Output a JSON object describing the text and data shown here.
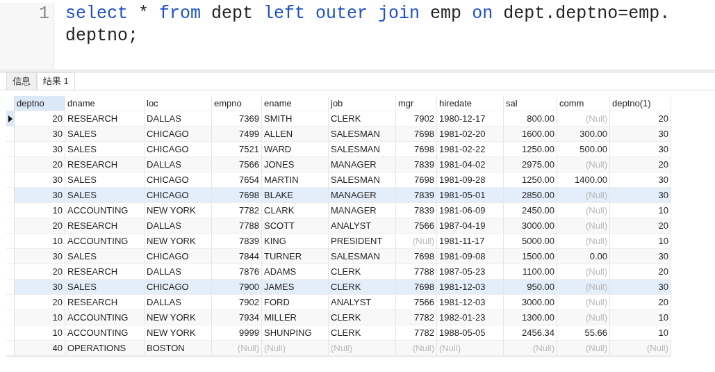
{
  "editor": {
    "line_number": "1",
    "tokens": [
      {
        "text": "select",
        "kind": "keyword"
      },
      {
        "text": " * ",
        "kind": "plain"
      },
      {
        "text": "from",
        "kind": "keyword"
      },
      {
        "text": " dept ",
        "kind": "plain"
      },
      {
        "text": "left outer join",
        "kind": "keyword"
      },
      {
        "text": " emp ",
        "kind": "plain"
      },
      {
        "text": "on",
        "kind": "keyword"
      },
      {
        "text": " dept.deptno=emp.deptno;",
        "kind": "plain"
      }
    ]
  },
  "tabs": [
    {
      "label": "信息",
      "selected": false
    },
    {
      "label": "结果 1",
      "selected": true
    }
  ],
  "table": {
    "columns": [
      {
        "label": "deptno",
        "kind": "number",
        "selected": true
      },
      {
        "label": "dname",
        "kind": "text",
        "selected": false
      },
      {
        "label": "loc",
        "kind": "text",
        "selected": false
      },
      {
        "label": "empno",
        "kind": "number",
        "selected": false
      },
      {
        "label": "ename",
        "kind": "text",
        "selected": false
      },
      {
        "label": "job",
        "kind": "text",
        "selected": false
      },
      {
        "label": "mgr",
        "kind": "number",
        "selected": false
      },
      {
        "label": "hiredate",
        "kind": "text",
        "selected": false
      },
      {
        "label": "sal",
        "kind": "number",
        "selected": false
      },
      {
        "label": "comm",
        "kind": "number",
        "selected": false
      },
      {
        "label": "deptno(1)",
        "kind": "number",
        "selected": false
      }
    ],
    "rows": [
      {
        "current": true,
        "highlighted": false,
        "cells": [
          "20",
          "RESEARCH",
          "DALLAS",
          "7369",
          "SMITH",
          "CLERK",
          "7902",
          "1980-12-17",
          "800.00",
          {
            "text": "(Null)",
            "kind": "null"
          },
          "20"
        ]
      },
      {
        "current": false,
        "highlighted": false,
        "cells": [
          "30",
          "SALES",
          "CHICAGO",
          "7499",
          "ALLEN",
          "SALESMAN",
          "7698",
          "1981-02-20",
          "1600.00",
          "300.00",
          "30"
        ]
      },
      {
        "current": false,
        "highlighted": false,
        "cells": [
          "30",
          "SALES",
          "CHICAGO",
          "7521",
          "WARD",
          "SALESMAN",
          "7698",
          "1981-02-22",
          "1250.00",
          "500.00",
          "30"
        ]
      },
      {
        "current": false,
        "highlighted": false,
        "cells": [
          "20",
          "RESEARCH",
          "DALLAS",
          "7566",
          "JONES",
          "MANAGER",
          "7839",
          "1981-04-02",
          "2975.00",
          {
            "text": "(Null)",
            "kind": "null"
          },
          "20"
        ]
      },
      {
        "current": false,
        "highlighted": false,
        "cells": [
          "30",
          "SALES",
          "CHICAGO",
          "7654",
          "MARTIN",
          "SALESMAN",
          "7698",
          "1981-09-28",
          "1250.00",
          "1400.00",
          "30"
        ]
      },
      {
        "current": false,
        "highlighted": true,
        "cells": [
          "30",
          "SALES",
          "CHICAGO",
          "7698",
          "BLAKE",
          "MANAGER",
          "7839",
          "1981-05-01",
          "2850.00",
          {
            "text": "(Null)",
            "kind": "null"
          },
          "30"
        ]
      },
      {
        "current": false,
        "highlighted": false,
        "cells": [
          "10",
          "ACCOUNTING",
          "NEW YORK",
          "7782",
          "CLARK",
          "MANAGER",
          "7839",
          "1981-06-09",
          "2450.00",
          {
            "text": "(Null)",
            "kind": "null"
          },
          "10"
        ]
      },
      {
        "current": false,
        "highlighted": false,
        "cells": [
          "20",
          "RESEARCH",
          "DALLAS",
          "7788",
          "SCOTT",
          "ANALYST",
          "7566",
          "1987-04-19",
          "3000.00",
          {
            "text": "(Null)",
            "kind": "null"
          },
          "20"
        ]
      },
      {
        "current": false,
        "highlighted": false,
        "cells": [
          "10",
          "ACCOUNTING",
          "NEW YORK",
          "7839",
          "KING",
          "PRESIDENT",
          {
            "text": "(Null)",
            "kind": "null"
          },
          "1981-11-17",
          "5000.00",
          {
            "text": "(Null)",
            "kind": "null"
          },
          "10"
        ]
      },
      {
        "current": false,
        "highlighted": false,
        "cells": [
          "30",
          "SALES",
          "CHICAGO",
          "7844",
          "TURNER",
          "SALESMAN",
          "7698",
          "1981-09-08",
          "1500.00",
          "0.00",
          "30"
        ]
      },
      {
        "current": false,
        "highlighted": false,
        "cells": [
          "20",
          "RESEARCH",
          "DALLAS",
          "7876",
          "ADAMS",
          "CLERK",
          "7788",
          "1987-05-23",
          "1100.00",
          {
            "text": "(Null)",
            "kind": "null"
          },
          "20"
        ]
      },
      {
        "current": false,
        "highlighted": true,
        "cells": [
          "30",
          "SALES",
          "CHICAGO",
          "7900",
          "JAMES",
          "CLERK",
          "7698",
          "1981-12-03",
          "950.00",
          {
            "text": "(Null)",
            "kind": "null"
          },
          "30"
        ]
      },
      {
        "current": false,
        "highlighted": false,
        "cells": [
          "20",
          "RESEARCH",
          "DALLAS",
          "7902",
          "FORD",
          "ANALYST",
          "7566",
          "1981-12-03",
          "3000.00",
          {
            "text": "(Null)",
            "kind": "null"
          },
          "20"
        ]
      },
      {
        "current": false,
        "highlighted": false,
        "cells": [
          "10",
          "ACCOUNTING",
          "NEW YORK",
          "7934",
          "MILLER",
          "CLERK",
          "7782",
          "1982-01-23",
          "1300.00",
          {
            "text": "(Null)",
            "kind": "null"
          },
          "10"
        ]
      },
      {
        "current": false,
        "highlighted": false,
        "cells": [
          "10",
          "ACCOUNTING",
          "NEW YORK",
          "9999",
          "SHUNPING",
          "CLERK",
          "7782",
          "1988-05-05",
          "2456.34",
          "55.66",
          "10"
        ]
      },
      {
        "current": false,
        "highlighted": false,
        "cells": [
          "40",
          "OPERATIONS",
          "BOSTON",
          {
            "text": "(Null)",
            "kind": "null"
          },
          {
            "text": "(Null)",
            "kind": "null"
          },
          {
            "text": "(Null)",
            "kind": "null"
          },
          {
            "text": "(Null)",
            "kind": "null"
          },
          {
            "text": "(Null)",
            "kind": "null"
          },
          {
            "text": "(Null)",
            "kind": "null"
          },
          {
            "text": "(Null)",
            "kind": "null"
          },
          {
            "text": "(Null)",
            "kind": "null"
          }
        ]
      }
    ]
  }
}
